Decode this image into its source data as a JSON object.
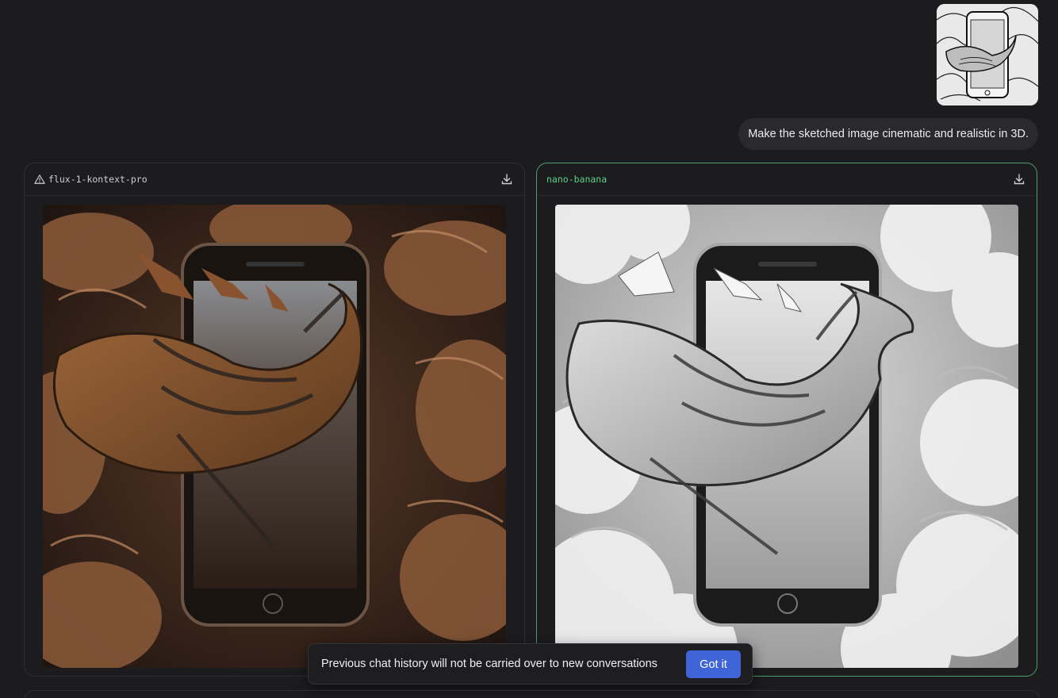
{
  "user_message": {
    "attachment_icon": "sketch-image-thumbnail",
    "prompt": "Make the sketched image cinematic and realistic in 3D."
  },
  "results": [
    {
      "model": "flux-1-kontext-pro",
      "status_icon": "warning-icon",
      "download_icon": "download-icon",
      "image_subject": "whale-phone-petals"
    },
    {
      "model": "nano-banana",
      "download_icon": "download-icon",
      "image_subject": "whale-phone-clouds",
      "selected": true,
      "accent": "#5fcf88"
    }
  ],
  "toast": {
    "message": "Previous chat history will not be carried over to new conversations",
    "button": "Got it",
    "button_color": "#3e64d8"
  }
}
